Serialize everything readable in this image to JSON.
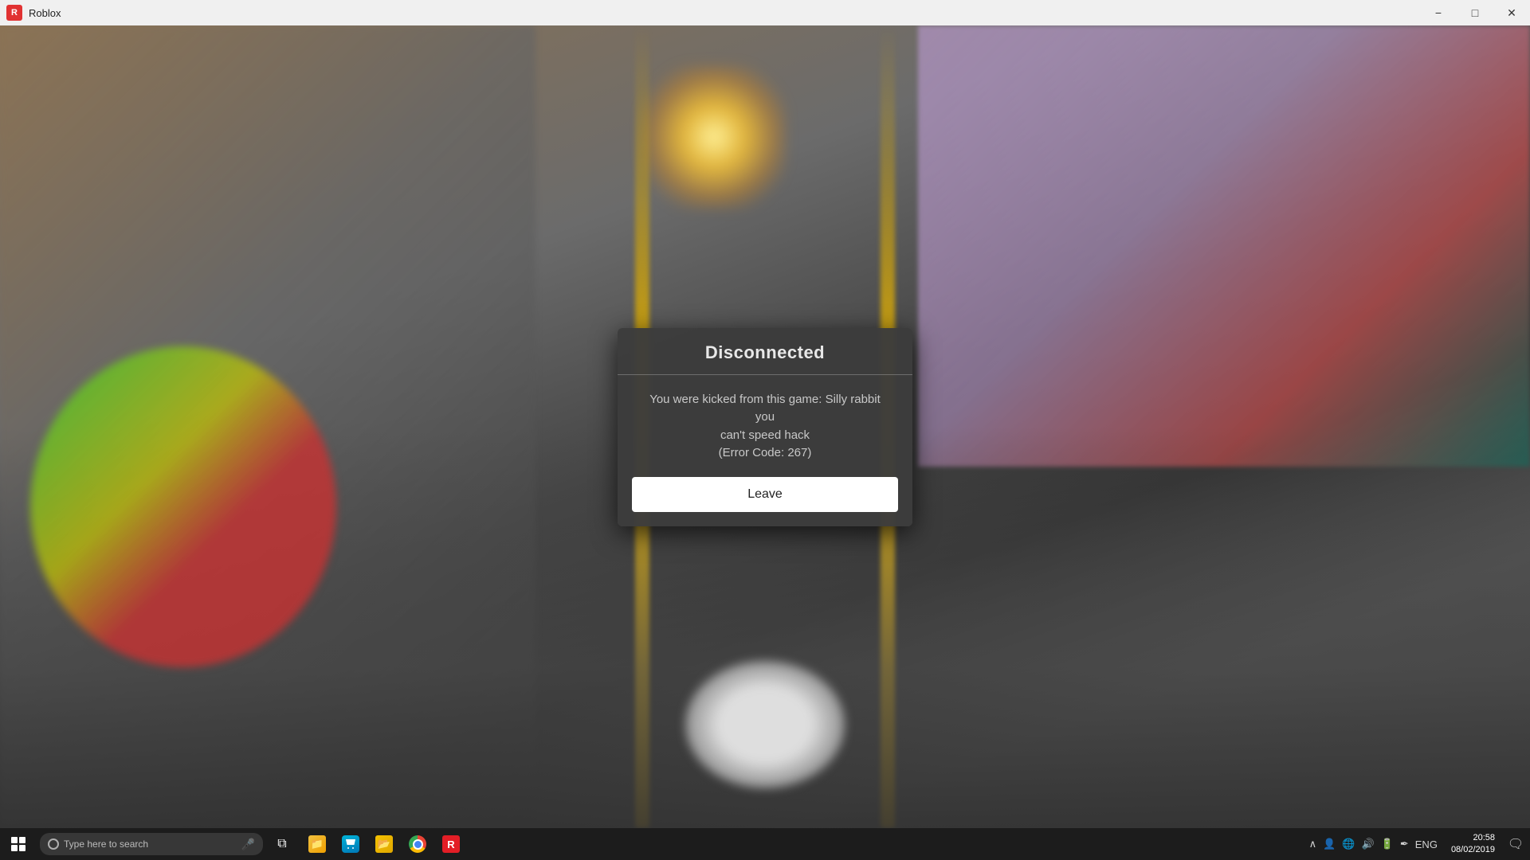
{
  "titlebar": {
    "title": "Roblox",
    "minimize_label": "−",
    "maximize_label": "□",
    "close_label": "✕"
  },
  "dialog": {
    "title": "Disconnected",
    "message_line1": "You were kicked from this game: Silly rabbit you",
    "message_line2": "can't speed hack",
    "message_line3": "(Error Code: 267)",
    "leave_button": "Leave"
  },
  "taskbar": {
    "search_placeholder": "Type here to search",
    "clock_time": "20:58",
    "clock_date": "08/02/2019",
    "lang": "ENG",
    "apps": [
      {
        "name": "task-view",
        "icon": "⊞"
      },
      {
        "name": "explorer",
        "label": "📁"
      },
      {
        "name": "store",
        "label": "🏪"
      },
      {
        "name": "folder",
        "label": "📂"
      },
      {
        "name": "chrome",
        "label": ""
      },
      {
        "name": "roblox",
        "label": "R"
      }
    ]
  }
}
